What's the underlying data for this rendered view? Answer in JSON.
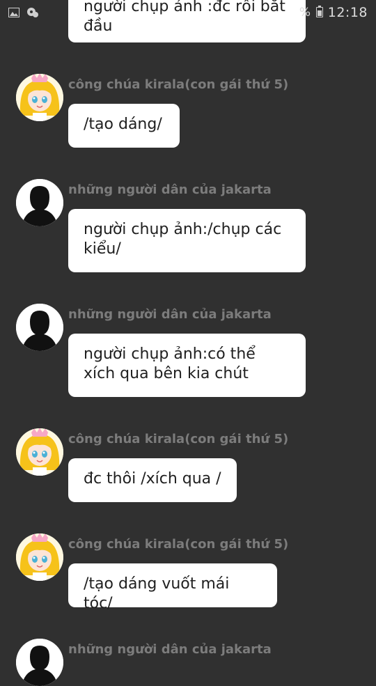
{
  "status_bar": {
    "time": "12:18",
    "battery_percent_symbol": "%",
    "icons": [
      "image-icon",
      "chat-bubble-icon"
    ]
  },
  "messages": [
    {
      "sender": "",
      "avatar": "",
      "text": "người chụp ảnh :đc rồi bắt đầu"
    },
    {
      "sender": "công chúa kirala(con gái thứ 5)",
      "avatar": "princess-avatar",
      "text": "/tạo dáng/"
    },
    {
      "sender": "những người dân của jakarta",
      "avatar": "silhouette-avatar",
      "text": "người chụp ảnh:/chụp các kiểu/"
    },
    {
      "sender": "những người dân của jakarta",
      "avatar": "silhouette-avatar",
      "text": "người chụp ảnh:có thể xích qua bên kia chút"
    },
    {
      "sender": "công chúa kirala(con gái thứ 5)",
      "avatar": "princess-avatar",
      "text": "đc thôi /xích qua /"
    },
    {
      "sender": "công chúa kirala(con gái thứ 5)",
      "avatar": "princess-avatar",
      "text": "/tạo dáng vuốt mái tóc/"
    },
    {
      "sender": "những người dân của jakarta",
      "avatar": "silhouette-avatar",
      "text": ""
    }
  ]
}
